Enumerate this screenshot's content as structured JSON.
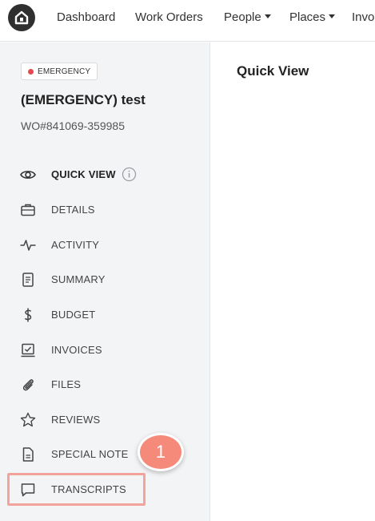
{
  "nav": {
    "items": [
      {
        "label": "Dashboard"
      },
      {
        "label": "Work Orders"
      },
      {
        "label": "People"
      },
      {
        "label": "Places"
      },
      {
        "label": "Invo"
      }
    ]
  },
  "work_order": {
    "badge": "EMERGENCY",
    "title": "(EMERGENCY) test",
    "number": "WO#841069-359985"
  },
  "sidebar": {
    "items": [
      {
        "label": "QUICK VIEW",
        "icon": "eye-icon"
      },
      {
        "label": "DETAILS",
        "icon": "briefcase-icon"
      },
      {
        "label": "ACTIVITY",
        "icon": "activity-pulse-icon"
      },
      {
        "label": "SUMMARY",
        "icon": "document-list-icon"
      },
      {
        "label": "BUDGET",
        "icon": "dollar-icon"
      },
      {
        "label": "INVOICES",
        "icon": "invoice-check-icon"
      },
      {
        "label": "FILES",
        "icon": "paperclip-icon"
      },
      {
        "label": "REVIEWS",
        "icon": "star-icon"
      },
      {
        "label": "SPECIAL NOTE",
        "icon": "note-file-icon"
      },
      {
        "label": "TRANSCRIPTS",
        "icon": "chat-bubble-icon"
      }
    ]
  },
  "main": {
    "title": "Quick View"
  },
  "annotation": {
    "step": "1"
  },
  "colors": {
    "emergency_dot": "#e5484d",
    "highlight": "#f4a39b",
    "step_circle": "#f5897a",
    "sidebar_bg": "#f3f4f6"
  }
}
